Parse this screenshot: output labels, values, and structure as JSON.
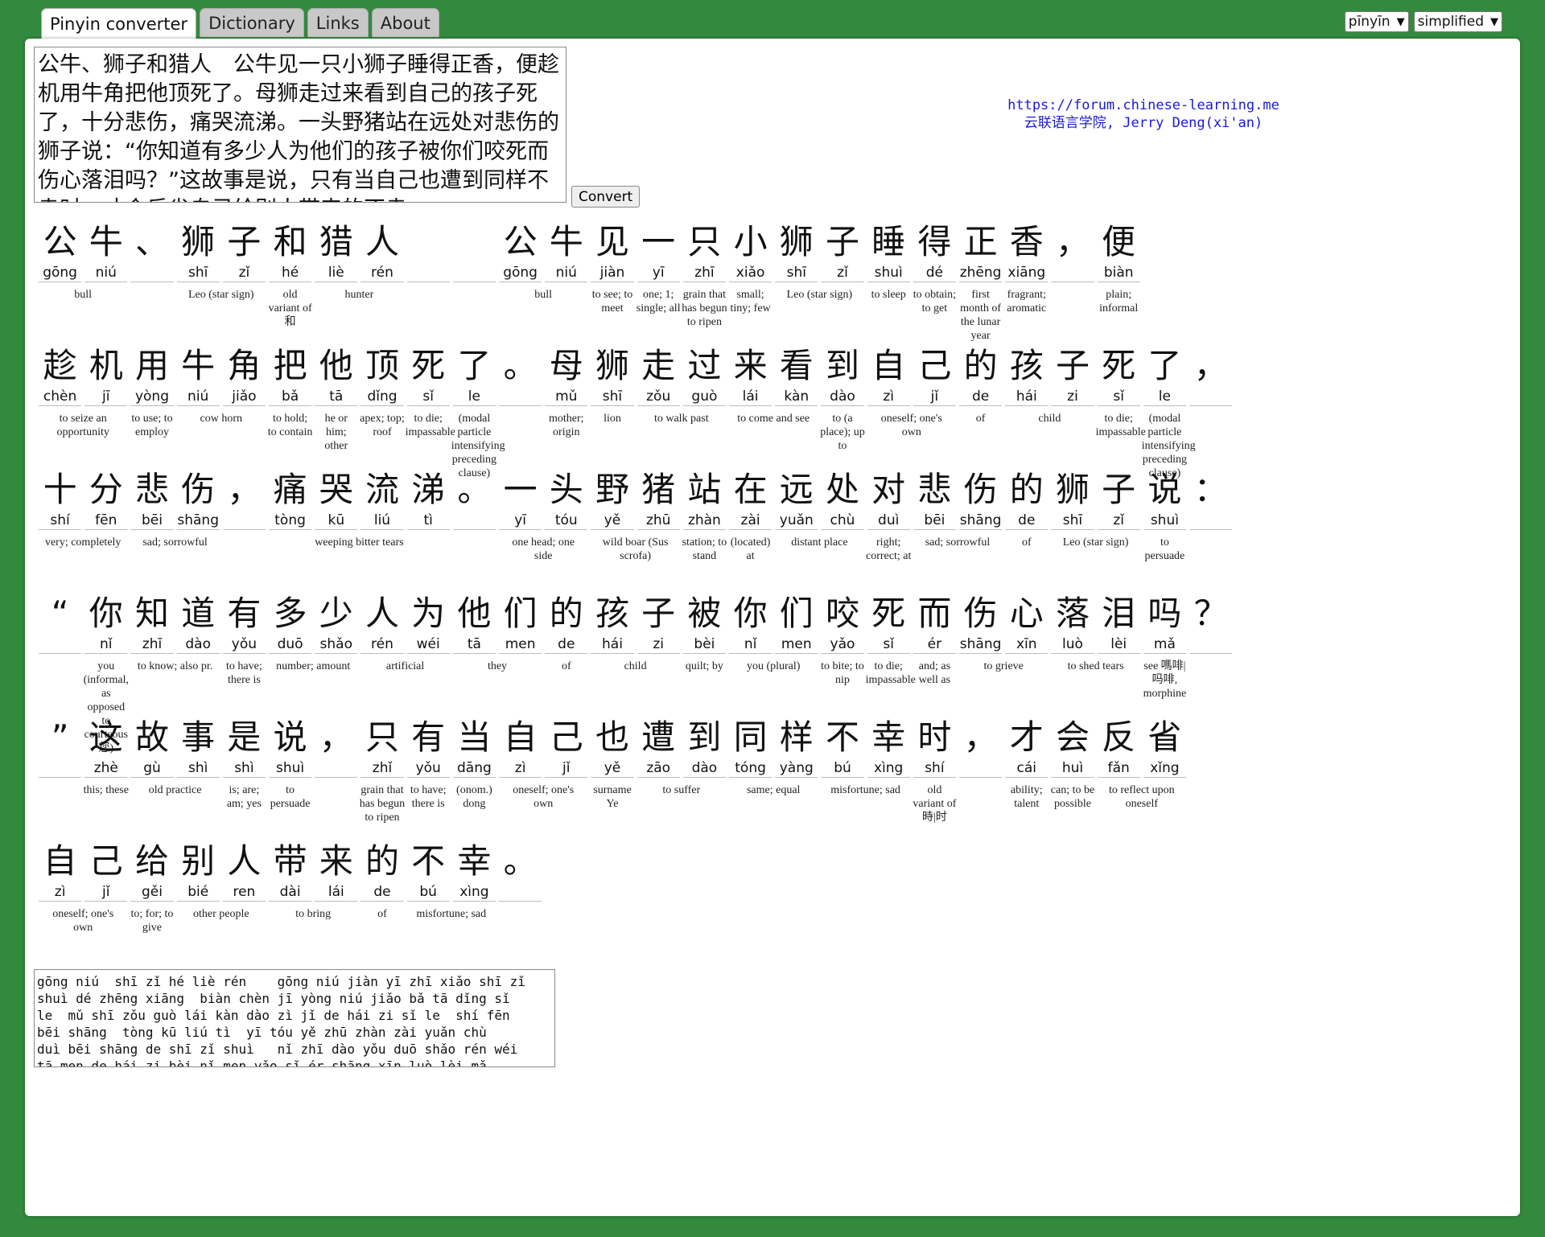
{
  "tabs": [
    {
      "label": "Pinyin converter",
      "active": true
    },
    {
      "label": "Dictionary",
      "active": false
    },
    {
      "label": "Links",
      "active": false
    },
    {
      "label": "About",
      "active": false
    }
  ],
  "selects": {
    "tone": "pīnyīn",
    "script": "simplified"
  },
  "input_text": "公牛、狮子和猎人　公牛见一只小狮子睡得正香，便趁机用牛角把他顶死了。母狮走过来看到自己的孩子死了，十分悲伤，痛哭流涕。一头野猪站在远处对悲伤的狮子说：“你知道有多少人为他们的孩子被你们咬死而伤心落泪吗？”这故事是说，只有当自己也遭到同样不幸时，才会反省自己给别人带来的不幸。",
  "convert_label": "Convert",
  "credit": {
    "url": "https://forum.chinese-learning.me",
    "author": "云联语言学院, Jerry Deng(xi'an)"
  },
  "rows": [
    {
      "cells": [
        {
          "h": "公",
          "p": "gōng"
        },
        {
          "h": "牛",
          "p": "niú"
        },
        {
          "h": "、",
          "p": ""
        },
        {
          "h": "狮",
          "p": "shī"
        },
        {
          "h": "子",
          "p": "zǐ"
        },
        {
          "h": "和",
          "p": "hé"
        },
        {
          "h": "猎",
          "p": "liè"
        },
        {
          "h": "人",
          "p": "rén"
        },
        {
          "h": "",
          "p": ""
        },
        {
          "h": "",
          "p": ""
        },
        {
          "h": "公",
          "p": "gōng"
        },
        {
          "h": "牛",
          "p": "niú"
        },
        {
          "h": "见",
          "p": "jiàn"
        },
        {
          "h": "一",
          "p": "yī"
        },
        {
          "h": "只",
          "p": "zhī"
        },
        {
          "h": "小",
          "p": "xiǎo"
        },
        {
          "h": "狮",
          "p": "shī"
        },
        {
          "h": "子",
          "p": "zǐ"
        },
        {
          "h": "睡",
          "p": "shuì"
        },
        {
          "h": "得",
          "p": "dé"
        },
        {
          "h": "正",
          "p": "zhēng"
        },
        {
          "h": "香",
          "p": "xiāng"
        },
        {
          "h": "，",
          "p": ""
        },
        {
          "h": "便",
          "p": "biàn"
        }
      ],
      "glosses": [
        {
          "s": 0,
          "n": 2,
          "t": "bull"
        },
        {
          "s": 3,
          "n": 2,
          "t": "Leo (star sign)"
        },
        {
          "s": 5,
          "n": 1,
          "t": "old variant of 和"
        },
        {
          "s": 6,
          "n": 2,
          "t": "hunter"
        },
        {
          "s": 10,
          "n": 2,
          "t": "bull"
        },
        {
          "s": 12,
          "n": 1,
          "t": "to see; to meet"
        },
        {
          "s": 13,
          "n": 1,
          "t": "one; 1; single; all"
        },
        {
          "s": 14,
          "n": 1,
          "t": "grain that has begun to ripen"
        },
        {
          "s": 15,
          "n": 1,
          "t": "small; tiny; few"
        },
        {
          "s": 16,
          "n": 2,
          "t": "Leo (star sign)"
        },
        {
          "s": 18,
          "n": 1,
          "t": "to sleep"
        },
        {
          "s": 19,
          "n": 1,
          "t": "to obtain; to get"
        },
        {
          "s": 20,
          "n": 1,
          "t": "first month of the lunar year"
        },
        {
          "s": 21,
          "n": 1,
          "t": "fragrant; aromatic"
        },
        {
          "s": 23,
          "n": 1,
          "t": "plain; informal"
        }
      ]
    },
    {
      "cells": [
        {
          "h": "趁",
          "p": "chèn"
        },
        {
          "h": "机",
          "p": "jī"
        },
        {
          "h": "用",
          "p": "yòng"
        },
        {
          "h": "牛",
          "p": "niú"
        },
        {
          "h": "角",
          "p": "jiǎo"
        },
        {
          "h": "把",
          "p": "bǎ"
        },
        {
          "h": "他",
          "p": "tā"
        },
        {
          "h": "顶",
          "p": "dǐng"
        },
        {
          "h": "死",
          "p": "sǐ"
        },
        {
          "h": "了",
          "p": "le"
        },
        {
          "h": "。",
          "p": ""
        },
        {
          "h": "母",
          "p": "mǔ"
        },
        {
          "h": "狮",
          "p": "shī"
        },
        {
          "h": "走",
          "p": "zǒu"
        },
        {
          "h": "过",
          "p": "guò"
        },
        {
          "h": "来",
          "p": "lái"
        },
        {
          "h": "看",
          "p": "kàn"
        },
        {
          "h": "到",
          "p": "dào"
        },
        {
          "h": "自",
          "p": "zì"
        },
        {
          "h": "己",
          "p": "jǐ"
        },
        {
          "h": "的",
          "p": "de"
        },
        {
          "h": "孩",
          "p": "hái"
        },
        {
          "h": "子",
          "p": "zi"
        },
        {
          "h": "死",
          "p": "sǐ"
        },
        {
          "h": "了",
          "p": "le"
        },
        {
          "h": "，",
          "p": ""
        }
      ],
      "glosses": [
        {
          "s": 0,
          "n": 2,
          "t": "to seize an opportunity"
        },
        {
          "s": 2,
          "n": 1,
          "t": "to use; to employ"
        },
        {
          "s": 3,
          "n": 2,
          "t": "cow horn"
        },
        {
          "s": 5,
          "n": 1,
          "t": "to hold; to contain"
        },
        {
          "s": 6,
          "n": 1,
          "t": "he or him; other"
        },
        {
          "s": 7,
          "n": 1,
          "t": "apex; top; roof"
        },
        {
          "s": 8,
          "n": 1,
          "t": "to die; impassable"
        },
        {
          "s": 9,
          "n": 1,
          "t": "(modal particle intensifying preceding clause)"
        },
        {
          "s": 11,
          "n": 1,
          "t": "mother; origin"
        },
        {
          "s": 12,
          "n": 1,
          "t": "lion"
        },
        {
          "s": 13,
          "n": 2,
          "t": "to walk past"
        },
        {
          "s": 15,
          "n": 2,
          "t": "to come and see"
        },
        {
          "s": 17,
          "n": 1,
          "t": "to (a place); up to"
        },
        {
          "s": 18,
          "n": 2,
          "t": "oneself; one's own"
        },
        {
          "s": 20,
          "n": 1,
          "t": "of"
        },
        {
          "s": 21,
          "n": 2,
          "t": "child"
        },
        {
          "s": 23,
          "n": 1,
          "t": "to die; impassable"
        },
        {
          "s": 24,
          "n": 1,
          "t": "(modal particle intensifying preceding clause)"
        }
      ]
    },
    {
      "cells": [
        {
          "h": "十",
          "p": "shí"
        },
        {
          "h": "分",
          "p": "fēn"
        },
        {
          "h": "悲",
          "p": "bēi"
        },
        {
          "h": "伤",
          "p": "shāng"
        },
        {
          "h": "，",
          "p": ""
        },
        {
          "h": "痛",
          "p": "tòng"
        },
        {
          "h": "哭",
          "p": "kū"
        },
        {
          "h": "流",
          "p": "liú"
        },
        {
          "h": "涕",
          "p": "tì"
        },
        {
          "h": "。",
          "p": ""
        },
        {
          "h": "一",
          "p": "yī"
        },
        {
          "h": "头",
          "p": "tóu"
        },
        {
          "h": "野",
          "p": "yě"
        },
        {
          "h": "猪",
          "p": "zhū"
        },
        {
          "h": "站",
          "p": "zhàn"
        },
        {
          "h": "在",
          "p": "zài"
        },
        {
          "h": "远",
          "p": "yuǎn"
        },
        {
          "h": "处",
          "p": "chù"
        },
        {
          "h": "对",
          "p": "duì"
        },
        {
          "h": "悲",
          "p": "bēi"
        },
        {
          "h": "伤",
          "p": "shāng"
        },
        {
          "h": "的",
          "p": "de"
        },
        {
          "h": "狮",
          "p": "shī"
        },
        {
          "h": "子",
          "p": "zǐ"
        },
        {
          "h": "说",
          "p": "shuì"
        },
        {
          "h": "：",
          "p": ""
        }
      ],
      "glosses": [
        {
          "s": 0,
          "n": 2,
          "t": "very; completely"
        },
        {
          "s": 2,
          "n": 2,
          "t": "sad; sorrowful"
        },
        {
          "s": 5,
          "n": 4,
          "t": "weeping bitter tears"
        },
        {
          "s": 10,
          "n": 2,
          "t": "one head; one side"
        },
        {
          "s": 12,
          "n": 2,
          "t": "wild boar (Sus scrofa)"
        },
        {
          "s": 14,
          "n": 1,
          "t": "station; to stand"
        },
        {
          "s": 15,
          "n": 1,
          "t": "(located) at"
        },
        {
          "s": 16,
          "n": 2,
          "t": "distant place"
        },
        {
          "s": 18,
          "n": 1,
          "t": "right; correct; at"
        },
        {
          "s": 19,
          "n": 2,
          "t": "sad; sorrowful"
        },
        {
          "s": 21,
          "n": 1,
          "t": "of"
        },
        {
          "s": 22,
          "n": 2,
          "t": "Leo (star sign)"
        },
        {
          "s": 24,
          "n": 1,
          "t": "to persuade"
        }
      ]
    },
    {
      "cells": [
        {
          "h": "“",
          "p": ""
        },
        {
          "h": "你",
          "p": "nǐ"
        },
        {
          "h": "知",
          "p": "zhī"
        },
        {
          "h": "道",
          "p": "dào"
        },
        {
          "h": "有",
          "p": "yǒu"
        },
        {
          "h": "多",
          "p": "duō"
        },
        {
          "h": "少",
          "p": "shǎo"
        },
        {
          "h": "人",
          "p": "rén"
        },
        {
          "h": "为",
          "p": "wéi"
        },
        {
          "h": "他",
          "p": "tā"
        },
        {
          "h": "们",
          "p": "men"
        },
        {
          "h": "的",
          "p": "de"
        },
        {
          "h": "孩",
          "p": "hái"
        },
        {
          "h": "子",
          "p": "zi"
        },
        {
          "h": "被",
          "p": "bèi"
        },
        {
          "h": "你",
          "p": "nǐ"
        },
        {
          "h": "们",
          "p": "men"
        },
        {
          "h": "咬",
          "p": "yǎo"
        },
        {
          "h": "死",
          "p": "sǐ"
        },
        {
          "h": "而",
          "p": "ér"
        },
        {
          "h": "伤",
          "p": "shāng"
        },
        {
          "h": "心",
          "p": "xīn"
        },
        {
          "h": "落",
          "p": "luò"
        },
        {
          "h": "泪",
          "p": "lèi"
        },
        {
          "h": "吗",
          "p": "mǎ"
        },
        {
          "h": "？",
          "p": ""
        }
      ],
      "glosses": [
        {
          "s": 1,
          "n": 1,
          "t": "you (informal, as opposed to courteous 您)"
        },
        {
          "s": 2,
          "n": 2,
          "t": "to know; also pr."
        },
        {
          "s": 4,
          "n": 1,
          "t": "to have; there is"
        },
        {
          "s": 5,
          "n": 2,
          "t": "number; amount"
        },
        {
          "s": 7,
          "n": 2,
          "t": "artificial"
        },
        {
          "s": 9,
          "n": 2,
          "t": "they"
        },
        {
          "s": 11,
          "n": 1,
          "t": "of"
        },
        {
          "s": 12,
          "n": 2,
          "t": "child"
        },
        {
          "s": 14,
          "n": 1,
          "t": "quilt; by"
        },
        {
          "s": 15,
          "n": 2,
          "t": "you (plural)"
        },
        {
          "s": 17,
          "n": 1,
          "t": "to bite; to nip"
        },
        {
          "s": 18,
          "n": 1,
          "t": "to die; impassable"
        },
        {
          "s": 19,
          "n": 1,
          "t": "and; as well as"
        },
        {
          "s": 20,
          "n": 2,
          "t": "to grieve"
        },
        {
          "s": 22,
          "n": 2,
          "t": "to shed tears"
        },
        {
          "s": 24,
          "n": 1,
          "t": "see 嗎啡|吗啡, morphine"
        }
      ]
    },
    {
      "cells": [
        {
          "h": "”",
          "p": ""
        },
        {
          "h": "这",
          "p": "zhè"
        },
        {
          "h": "故",
          "p": "gù"
        },
        {
          "h": "事",
          "p": "shì"
        },
        {
          "h": "是",
          "p": "shì"
        },
        {
          "h": "说",
          "p": "shuì"
        },
        {
          "h": "，",
          "p": ""
        },
        {
          "h": "只",
          "p": "zhǐ"
        },
        {
          "h": "有",
          "p": "yǒu"
        },
        {
          "h": "当",
          "p": "dāng"
        },
        {
          "h": "自",
          "p": "zì"
        },
        {
          "h": "己",
          "p": "jǐ"
        },
        {
          "h": "也",
          "p": "yě"
        },
        {
          "h": "遭",
          "p": "zāo"
        },
        {
          "h": "到",
          "p": "dào"
        },
        {
          "h": "同",
          "p": "tóng"
        },
        {
          "h": "样",
          "p": "yàng"
        },
        {
          "h": "不",
          "p": "bú"
        },
        {
          "h": "幸",
          "p": "xìng"
        },
        {
          "h": "时",
          "p": "shí"
        },
        {
          "h": "，",
          "p": ""
        },
        {
          "h": "才",
          "p": "cái"
        },
        {
          "h": "会",
          "p": "huì"
        },
        {
          "h": "反",
          "p": "fǎn"
        },
        {
          "h": "省",
          "p": "xǐng"
        }
      ],
      "glosses": [
        {
          "s": 1,
          "n": 1,
          "t": "this; these"
        },
        {
          "s": 2,
          "n": 2,
          "t": "old practice"
        },
        {
          "s": 4,
          "n": 1,
          "t": "is; are; am; yes"
        },
        {
          "s": 5,
          "n": 1,
          "t": "to persuade"
        },
        {
          "s": 7,
          "n": 1,
          "t": "grain that has begun to ripen"
        },
        {
          "s": 8,
          "n": 1,
          "t": "to have; there is"
        },
        {
          "s": 9,
          "n": 1,
          "t": "(onom.) dong"
        },
        {
          "s": 10,
          "n": 2,
          "t": "oneself; one's own"
        },
        {
          "s": 12,
          "n": 1,
          "t": "surname Ye"
        },
        {
          "s": 13,
          "n": 2,
          "t": "to suffer"
        },
        {
          "s": 15,
          "n": 2,
          "t": "same; equal"
        },
        {
          "s": 17,
          "n": 2,
          "t": "misfortune; sad"
        },
        {
          "s": 19,
          "n": 1,
          "t": "old variant of 時|时"
        },
        {
          "s": 21,
          "n": 1,
          "t": "ability; talent"
        },
        {
          "s": 22,
          "n": 1,
          "t": "can; to be possible"
        },
        {
          "s": 23,
          "n": 2,
          "t": "to reflect upon oneself"
        }
      ]
    },
    {
      "cells": [
        {
          "h": "自",
          "p": "zì"
        },
        {
          "h": "己",
          "p": "jǐ"
        },
        {
          "h": "给",
          "p": "gěi"
        },
        {
          "h": "别",
          "p": "bié"
        },
        {
          "h": "人",
          "p": "ren"
        },
        {
          "h": "带",
          "p": "dài"
        },
        {
          "h": "来",
          "p": "lái"
        },
        {
          "h": "的",
          "p": "de"
        },
        {
          "h": "不",
          "p": "bú"
        },
        {
          "h": "幸",
          "p": "xìng"
        },
        {
          "h": "。",
          "p": ""
        }
      ],
      "glosses": [
        {
          "s": 0,
          "n": 2,
          "t": "oneself; one's own"
        },
        {
          "s": 2,
          "n": 1,
          "t": "to; for; to give"
        },
        {
          "s": 3,
          "n": 2,
          "t": "other people"
        },
        {
          "s": 5,
          "n": 2,
          "t": "to bring"
        },
        {
          "s": 7,
          "n": 1,
          "t": "of"
        },
        {
          "s": 8,
          "n": 2,
          "t": "misfortune; sad"
        }
      ]
    }
  ],
  "output_text": "gōng niú  shī zǐ hé liè rén    gōng niú jiàn yī zhī xiǎo shī zǐ\nshuì dé zhēng xiāng  biàn chèn jī yòng niú jiǎo bǎ tā dǐng sǐ\nle  mǔ shī zǒu guò lái kàn dào zì jǐ de hái zi sǐ le  shí fēn\nbēi shāng  tòng kū liú tì  yī tóu yě zhū zhàn zài yuǎn chù\nduì bēi shāng de shī zǐ shuì   nǐ zhī dào yǒu duō shǎo rén wéi\ntā men de hái zi bèi nǐ men yǎo sǐ ér shāng xīn luò lèi mǎ"
}
